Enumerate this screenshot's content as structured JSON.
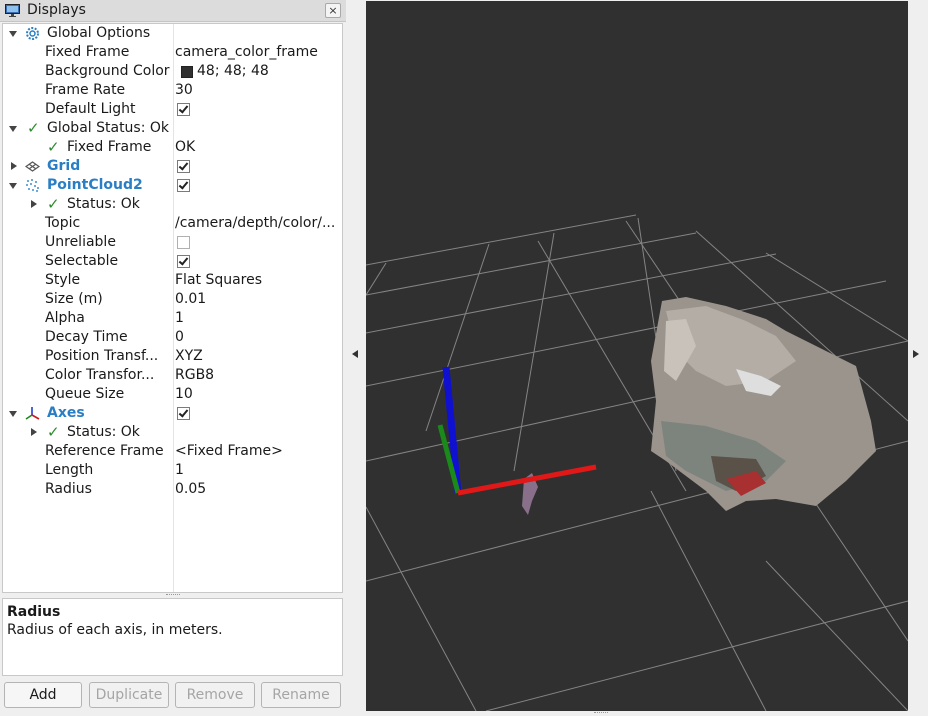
{
  "panel": {
    "title": "Displays",
    "close_label": "×"
  },
  "tree": {
    "global_options": {
      "label": "Global Options",
      "fixed_frame_label": "Fixed Frame",
      "fixed_frame_value": "camera_color_frame",
      "background_color_label": "Background Color",
      "background_color_value": "48; 48; 48",
      "frame_rate_label": "Frame Rate",
      "frame_rate_value": "30",
      "default_light_label": "Default Light",
      "default_light_checked": true
    },
    "global_status": {
      "label": "Global Status: Ok",
      "fixed_frame_label": "Fixed Frame",
      "fixed_frame_value": "OK"
    },
    "grid": {
      "label": "Grid",
      "enabled": true
    },
    "pointcloud2": {
      "label": "PointCloud2",
      "enabled": true,
      "status_label": "Status: Ok",
      "topic_label": "Topic",
      "topic_value": "/camera/depth/color/...",
      "unreliable_label": "Unreliable",
      "unreliable_checked": false,
      "selectable_label": "Selectable",
      "selectable_checked": true,
      "style_label": "Style",
      "style_value": "Flat Squares",
      "size_label": "Size (m)",
      "size_value": "0.01",
      "alpha_label": "Alpha",
      "alpha_value": "1",
      "decay_label": "Decay Time",
      "decay_value": "0",
      "position_label": "Position Transf...",
      "position_value": "XYZ",
      "color_label": "Color Transfor...",
      "color_value": "RGB8",
      "queue_label": "Queue Size",
      "queue_value": "10"
    },
    "axes": {
      "label": "Axes",
      "enabled": true,
      "status_label": "Status: Ok",
      "reference_frame_label": "Reference Frame",
      "reference_frame_value": "<Fixed Frame>",
      "length_label": "Length",
      "length_value": "1",
      "radius_label": "Radius",
      "radius_value": "0.05"
    }
  },
  "description": {
    "title": "Radius",
    "text": "Radius of each axis, in meters."
  },
  "buttons": {
    "add": "Add",
    "duplicate": "Duplicate",
    "remove": "Remove",
    "rename": "Rename"
  },
  "colors": {
    "viewport_background": "#303030",
    "link_blue": "#2a7ec4",
    "status_green": "#2e8b2e",
    "axis_x": "#e01818",
    "axis_y": "#1a8a1a",
    "axis_z": "#1010d0"
  },
  "icons": {
    "panel": "monitor-icon",
    "global_options": "gear-icon",
    "grid": "grid-icon",
    "pointcloud2": "pointcloud-icon",
    "axes": "axes-icon",
    "status": "checkmark-icon"
  }
}
